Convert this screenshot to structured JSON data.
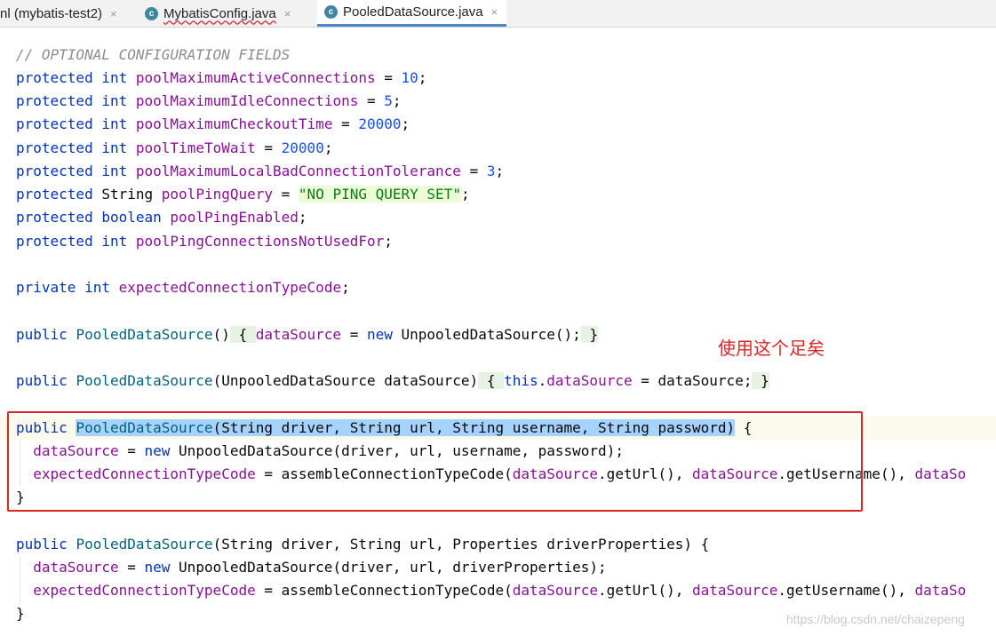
{
  "tabs": [
    {
      "label": "nl (mybatis-test2)",
      "has_icon": false
    },
    {
      "label": "MybatisConfig.java",
      "has_icon": true,
      "icon": "java-class-icon"
    },
    {
      "label": "PooledDataSource.java",
      "has_icon": true,
      "icon": "java-class-icon",
      "active": true
    }
  ],
  "close_glyph": "×",
  "class_icon_letter": "c",
  "code": {
    "comment": "// OPTIONAL CONFIGURATION FIELDS",
    "kw_protected": "protected",
    "kw_int": "int",
    "kw_boolean": "boolean",
    "kw_private": "private",
    "kw_public": "public",
    "kw_new": "new",
    "kw_this": "this",
    "type_String": "String",
    "f1": "poolMaximumActiveConnections",
    "v1": "10",
    "f2": "poolMaximumIdleConnections",
    "v2": "5",
    "f3": "poolMaximumCheckoutTime",
    "v3": "20000",
    "f4": "poolTimeToWait",
    "v4": "20000",
    "f5": "poolMaximumLocalBadConnectionTolerance",
    "v5": "3",
    "f6": "poolPingQuery",
    "v6": "\"NO PING QUERY SET\"",
    "f7": "poolPingEnabled",
    "f8": "poolPingConnectionsNotUsedFor",
    "f9": "expectedConnectionTypeCode",
    "ctor": "PooledDataSource",
    "ds": "dataSource",
    "unpooled_ctor": "UnpooledDataSource();",
    "ctor2_params": "(UnpooledDataSource dataSource)",
    "ctor2_tail": " = dataSource;",
    "ctor3_params": "(String driver, String url, String username, String password)",
    "ctor3_body1": "UnpooledDataSource(driver, url, username, password);",
    "assemble_call": "assembleConnectionTypeCode(",
    "get_url": ".getUrl(), ",
    "get_user": ".getUsername(), ",
    "trunc_ds": "dataSo",
    "ctor4_params": "(String driver, String url, Properties driverProperties) {",
    "ctor4_body1": "UnpooledDataSource(driver, url, driverProperties);"
  },
  "annotation": "使用这个足矣",
  "watermark": "https://blog.csdn.net/chaizepeng"
}
